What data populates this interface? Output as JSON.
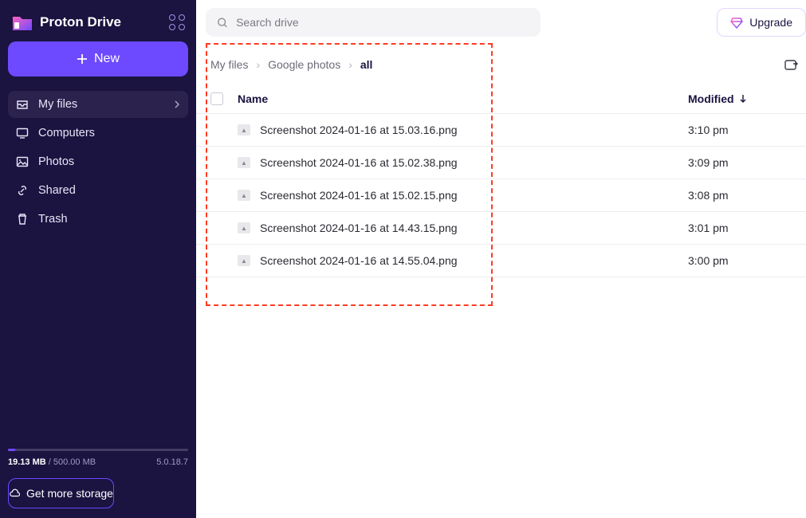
{
  "brand": {
    "name": "Proton Drive"
  },
  "sidebar": {
    "new_label": "New",
    "items": [
      {
        "label": "My files",
        "active": true,
        "icon": "inbox-icon",
        "expandable": true
      },
      {
        "label": "Computers",
        "active": false,
        "icon": "monitor-icon",
        "expandable": false
      },
      {
        "label": "Photos",
        "active": false,
        "icon": "image-icon",
        "expandable": false
      },
      {
        "label": "Shared",
        "active": false,
        "icon": "link-icon",
        "expandable": false
      },
      {
        "label": "Trash",
        "active": false,
        "icon": "trash-icon",
        "expandable": false
      }
    ],
    "storage": {
      "used_label": "19.13 MB",
      "total_label": " / 500.00 MB",
      "version": "5.0.18.7",
      "more_label": "Get more storage"
    }
  },
  "topbar": {
    "search_placeholder": "Search drive",
    "upgrade_label": "Upgrade"
  },
  "breadcrumb": {
    "items": [
      "My files",
      "Google photos"
    ],
    "current": "all"
  },
  "table": {
    "columns": {
      "name": "Name",
      "modified": "Modified"
    },
    "rows": [
      {
        "name": "Screenshot 2024-01-16 at 15.03.16.png",
        "modified": "3:10 pm"
      },
      {
        "name": "Screenshot 2024-01-16 at 15.02.38.png",
        "modified": "3:09 pm"
      },
      {
        "name": "Screenshot 2024-01-16 at 15.02.15.png",
        "modified": "3:08 pm"
      },
      {
        "name": "Screenshot 2024-01-16 at 14.43.15.png",
        "modified": "3:01 pm"
      },
      {
        "name": "Screenshot 2024-01-16 at 14.55.04.png",
        "modified": "3:00 pm"
      }
    ]
  }
}
